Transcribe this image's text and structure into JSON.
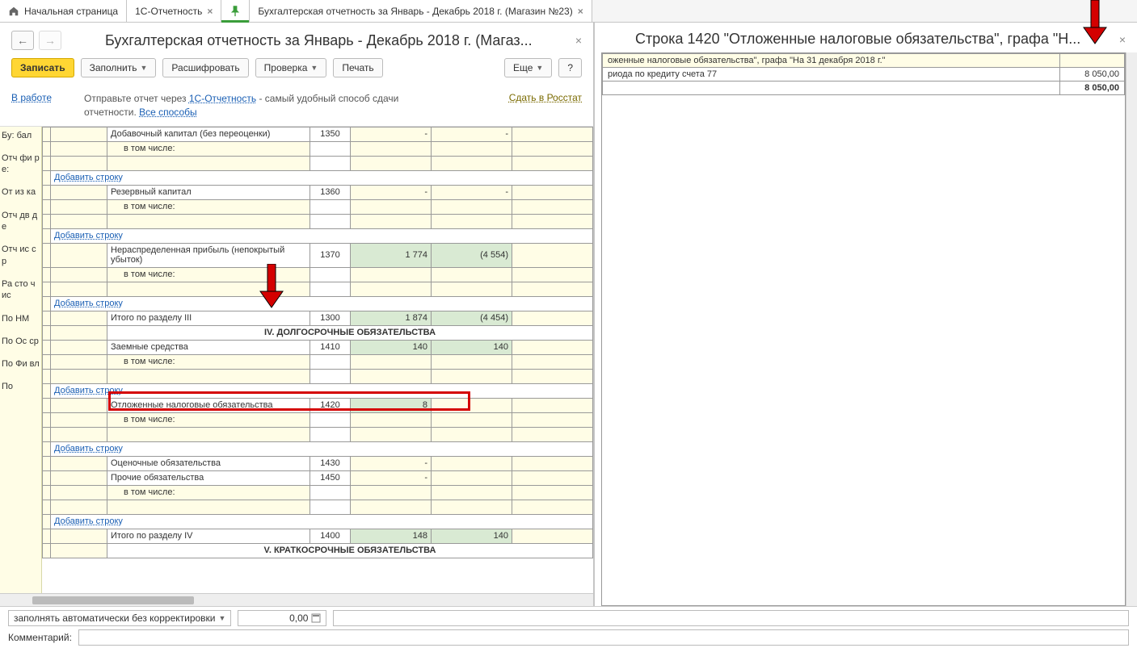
{
  "tabs": {
    "home": "Начальная страница",
    "t1": "1С-Отчетность",
    "t3": "Бухгалтерская отчетность за Январь - Декабрь 2018 г. (Магазин №23)"
  },
  "left": {
    "title": "Бухгалтерская отчетность за Январь - Декабрь 2018 г. (Магаз...",
    "buttons": {
      "save": "Записать",
      "fill": "Заполнить",
      "decode": "Расшифровать",
      "check": "Проверка",
      "print": "Печать",
      "more": "Еще",
      "help": "?"
    },
    "status": "В работе",
    "info_prefix": "Отправьте отчет через ",
    "info_link1": "1С-Отчетность",
    "info_mid": " - самый удобный способ сдачи отчетности. ",
    "info_link2": "Все способы",
    "rosstat": "Сдать в Росстат",
    "sidebar": [
      "Бу: бал",
      "Отч фи ре:",
      "От из ка",
      "Отч дв де",
      "Отч ис ср",
      "Ра сто чис",
      "По НМ",
      "По Ос ср",
      "По Фи вл",
      "По"
    ],
    "addrow": "Добавить строку",
    "rows": {
      "r1350": {
        "label": "Добавочный капитал (без переоценки)",
        "code": "1350",
        "v1": "-",
        "v2": "-"
      },
      "incl": "в том числе:",
      "r1360": {
        "label": "Резервный капитал",
        "code": "1360",
        "v1": "-",
        "v2": "-"
      },
      "r1370": {
        "label": "Нераспределенная прибыль (непокрытый убыток)",
        "code": "1370",
        "v1": "1 774",
        "v2": "(4 554)"
      },
      "r1300": {
        "label": "Итого по разделу III",
        "code": "1300",
        "v1": "1 874",
        "v2": "(4 454)"
      },
      "sec4": "IV. ДОЛГОСРОЧНЫЕ ОБЯЗАТЕЛЬСТВА",
      "r1410": {
        "label": "Заемные средства",
        "code": "1410",
        "v1": "140",
        "v2": "140"
      },
      "r1420": {
        "label": "Отложенные налоговые обязательства",
        "code": "1420",
        "v1": "8",
        "v2": ""
      },
      "r1430": {
        "label": "Оценочные обязательства",
        "code": "1430",
        "v1": "-",
        "v2": ""
      },
      "r1450": {
        "label": "Прочие обязательства",
        "code": "1450",
        "v1": "-",
        "v2": ""
      },
      "r1400": {
        "label": "Итого по разделу IV",
        "code": "1400",
        "v1": "148",
        "v2": "140"
      },
      "sec5": "V. КРАТКОСРОЧНЫЕ ОБЯЗАТЕЛЬСТВА"
    }
  },
  "right": {
    "title": "Строка 1420 \"Отложенные налоговые обязательства\", графа \"Н...",
    "row1_label": "оженные налоговые обязательства\", графа \"На 31 декабря 2018 г.\"",
    "row2_label": "риода по кредиту счета 77",
    "row2_val": "8 050,00",
    "row3_val": "8 050,00"
  },
  "bottom": {
    "combo": "заполнять автоматически без корректировки",
    "num": "0,00",
    "comment_label": "Комментарий:"
  }
}
